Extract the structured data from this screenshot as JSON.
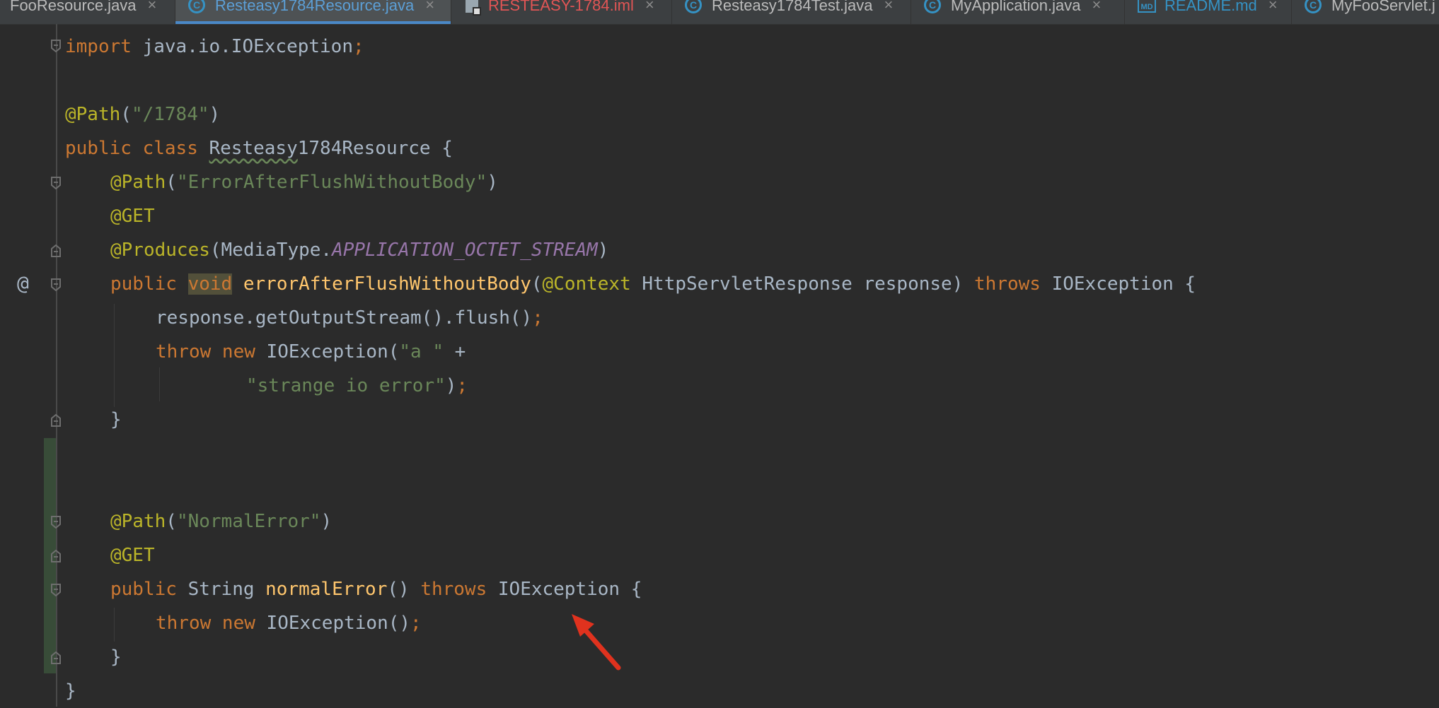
{
  "tabs": [
    {
      "label": "FooResource.java",
      "icon": "java-class-icon",
      "active": false
    },
    {
      "label": "Resteasy1784Resource.java",
      "icon": "java-class-icon",
      "active": true
    },
    {
      "label": "RESTEASY-1784.iml",
      "icon": "iml-file-icon",
      "active": false,
      "color": "#e05555"
    },
    {
      "label": "Resteasy1784Test.java",
      "icon": "java-class-icon",
      "active": false
    },
    {
      "label": "MyApplication.java",
      "icon": "java-class-icon",
      "active": false
    },
    {
      "label": "README.md",
      "icon": "markdown-file-icon",
      "active": false,
      "color": "#3592c4"
    },
    {
      "label": "MyFooServlet.j",
      "icon": "java-class-icon",
      "active": false
    }
  ],
  "tab_close_glyph": "×",
  "class_icon_letter": "C",
  "md_icon_text": "MD",
  "gutter_at_symbol": "@",
  "code": {
    "l1": {
      "kw": "import",
      "rest": " java.io.IOException",
      "semi": ";"
    },
    "l3": {
      "ann": "@Path",
      "p1": "(",
      "str": "\"/1784\"",
      "p2": ")"
    },
    "l4": {
      "kw1": "public",
      "kw2": " class ",
      "cls_a": "Resteasy",
      "cls_b": "1784Resource",
      "rest": " {"
    },
    "l5": {
      "ann": "@Path",
      "p1": "(",
      "str": "\"ErrorAfterFlushWithoutBody\"",
      "p2": ")"
    },
    "l6": {
      "ann": "@GET"
    },
    "l7": {
      "ann": "@Produces",
      "p1": "(MediaType.",
      "const": "APPLICATION_OCTET_STREAM",
      "p2": ")"
    },
    "l8": {
      "kw1": "public ",
      "kw2": "void",
      "sp": " ",
      "fn": "errorAfterFlushWithoutBody",
      "p1": "(",
      "ann": "@Context",
      "p2": " HttpServletResponse response) ",
      "kw3": "throws",
      "p3": " IOException {"
    },
    "l9": {
      "text": "response.getOutputStream().flush()",
      "semi": ";"
    },
    "l10": {
      "kw1": "throw ",
      "kw2": "new",
      "p1": " IOException(",
      "str": "\"a \"",
      "p2": " +"
    },
    "l11": {
      "str": "\"strange io error\"",
      "p1": ")",
      "semi": ";"
    },
    "l12": {
      "text": "}"
    },
    "l15": {
      "ann": "@Path",
      "p1": "(",
      "str": "\"NormalError\"",
      "p2": ")"
    },
    "l16": {
      "ann": "@GET"
    },
    "l17": {
      "kw1": "public",
      "p1": " String ",
      "fn": "normalError",
      "p2": "() ",
      "kw2": "throws",
      "p3": " IOException {"
    },
    "l18": {
      "kw1": "throw ",
      "kw2": "new",
      "p1": " IOException()",
      "semi": ";"
    },
    "l19": {
      "text": "}"
    },
    "l20": {
      "text": "}"
    }
  },
  "colors": {
    "background": "#2b2b2b",
    "keyword": "#cc7832",
    "annotation": "#bbb529",
    "string": "#6a8759",
    "method": "#ffc66d",
    "constant": "#9876aa",
    "text": "#a9b7c6",
    "arrow": "#e0321e",
    "active_tab_underline": "#4a88c7"
  }
}
